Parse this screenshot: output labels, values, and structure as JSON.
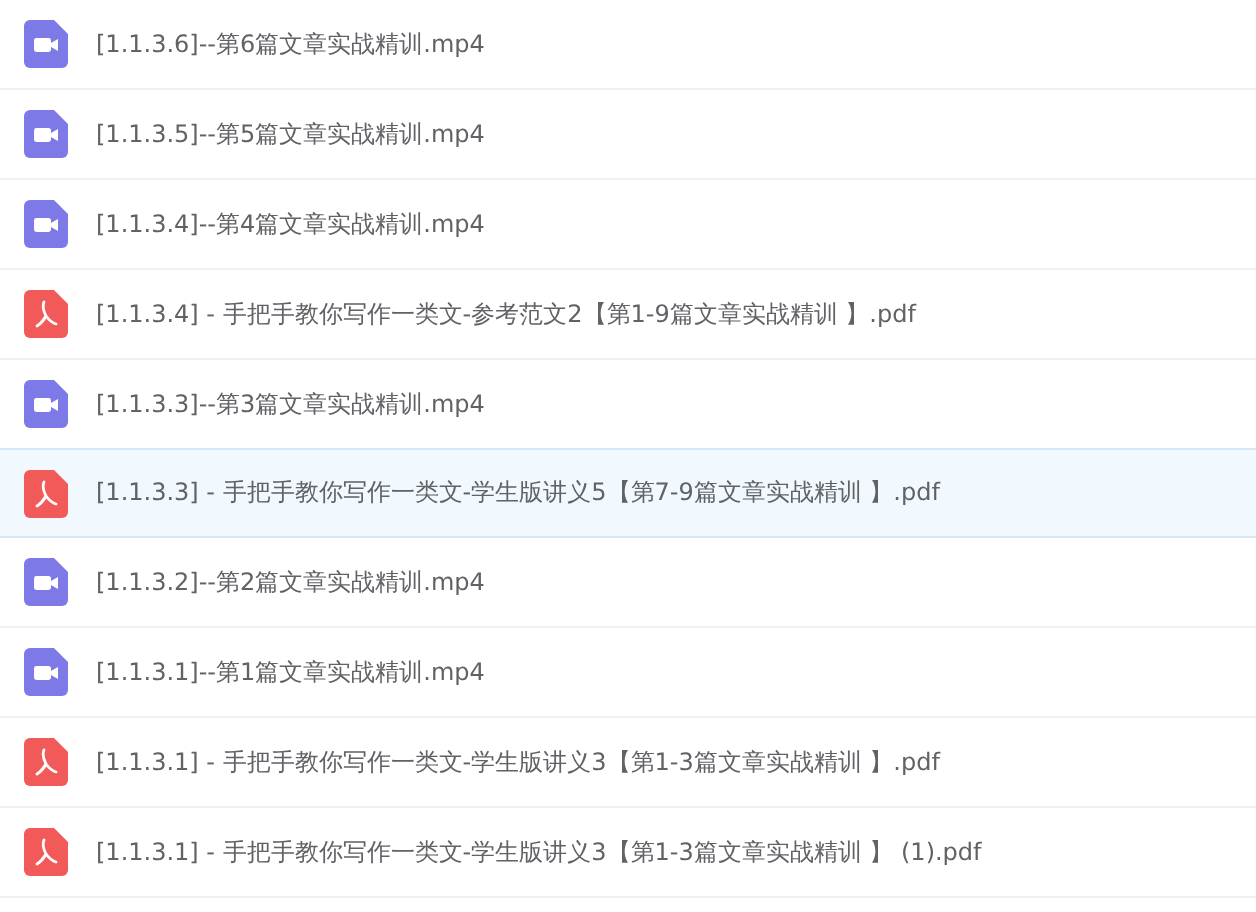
{
  "files": [
    {
      "kind": "video",
      "name": "[1.1.3.6]--第6篇文章实战精训.mp4",
      "selected": false
    },
    {
      "kind": "video",
      "name": "[1.1.3.5]--第5篇文章实战精训.mp4",
      "selected": false
    },
    {
      "kind": "video",
      "name": "[1.1.3.4]--第4篇文章实战精训.mp4",
      "selected": false
    },
    {
      "kind": "pdf",
      "name": "[1.1.3.4] - 手把手教你写作一类文-参考范文2【第1-9篇文章实战精训 】.pdf",
      "selected": false
    },
    {
      "kind": "video",
      "name": "[1.1.3.3]--第3篇文章实战精训.mp4",
      "selected": false
    },
    {
      "kind": "pdf",
      "name": "[1.1.3.3] - 手把手教你写作一类文-学生版讲义5【第7-9篇文章实战精训 】.pdf",
      "selected": true
    },
    {
      "kind": "video",
      "name": "[1.1.3.2]--第2篇文章实战精训.mp4",
      "selected": false
    },
    {
      "kind": "video",
      "name": "[1.1.3.1]--第1篇文章实战精训.mp4",
      "selected": false
    },
    {
      "kind": "pdf",
      "name": "[1.1.3.1] - 手把手教你写作一类文-学生版讲义3【第1-3篇文章实战精训 】.pdf",
      "selected": false
    },
    {
      "kind": "pdf",
      "name": "[1.1.3.1] - 手把手教你写作一类文-学生版讲义3【第1-3篇文章实战精训 】 (1).pdf",
      "selected": false
    }
  ]
}
